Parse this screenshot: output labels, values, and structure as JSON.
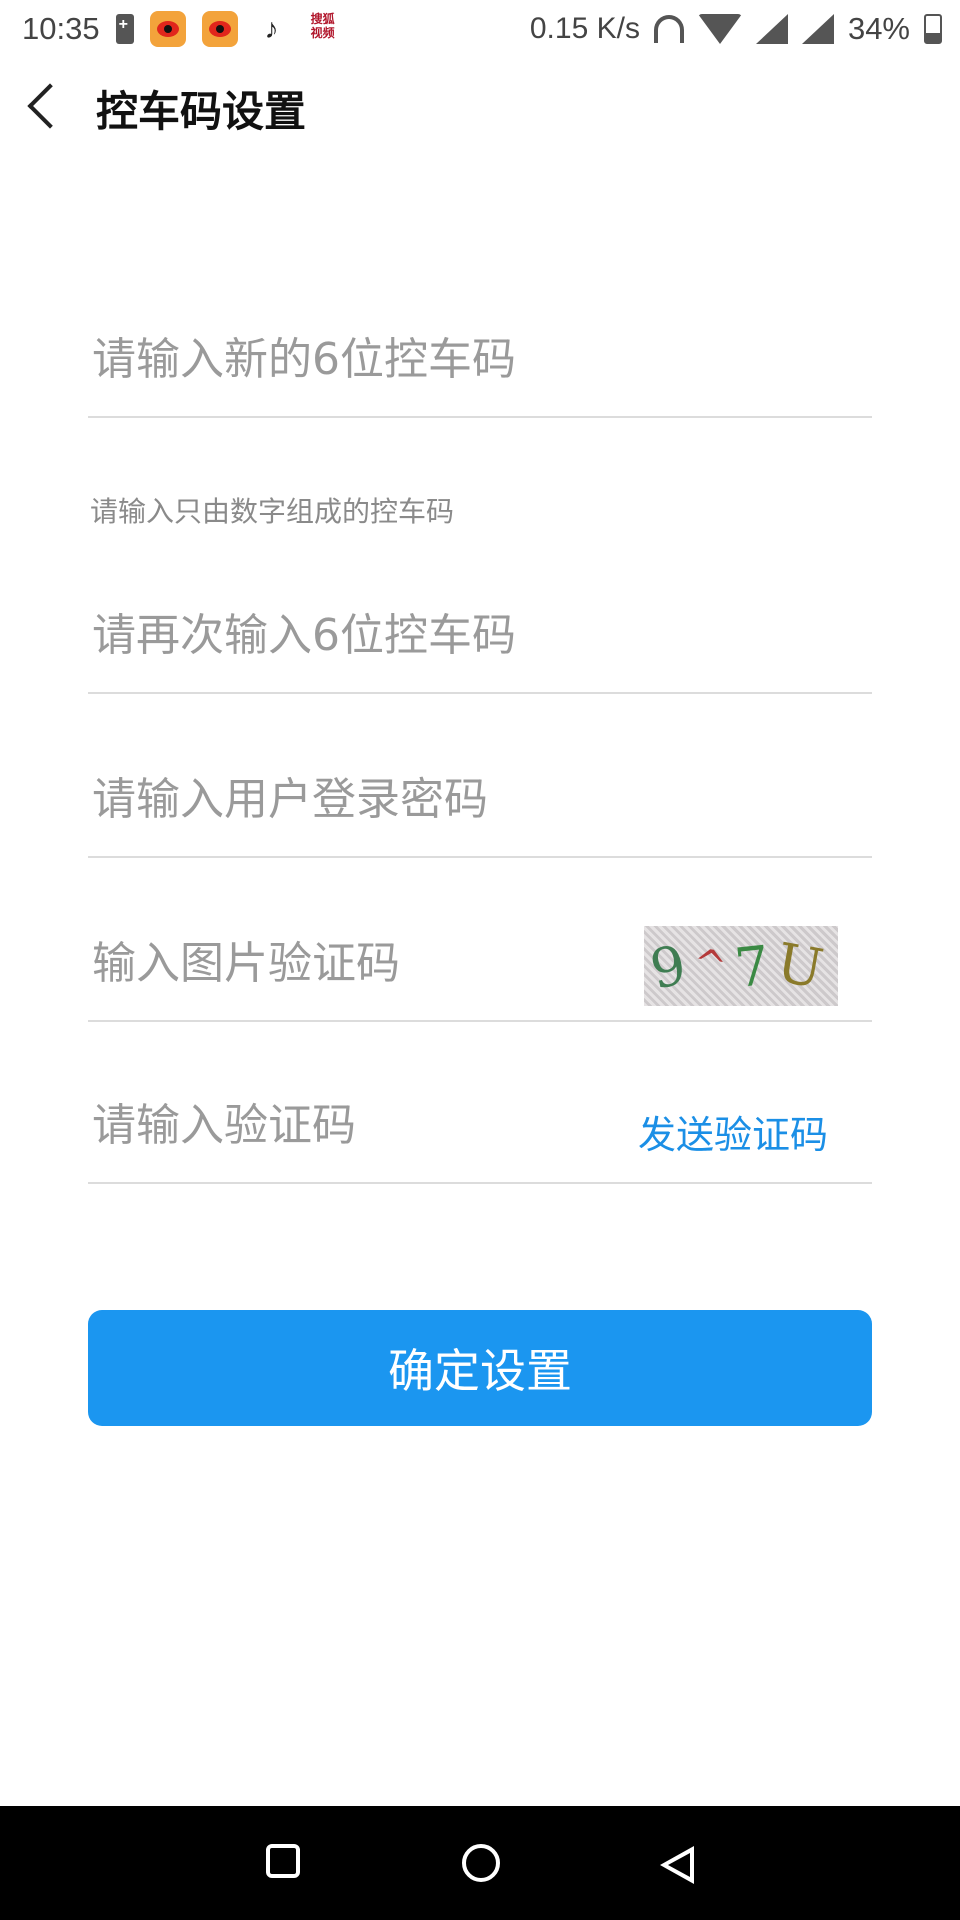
{
  "status_bar": {
    "time": "10:35",
    "net_speed": "0.15 K/s",
    "battery": "34%",
    "battery_level": 0.34,
    "icons": [
      "battery-saver-icon",
      "weibo-icon",
      "weibo-icon",
      "tiktok-icon",
      "sohu-video-icon",
      "headphone-icon",
      "wifi-icon",
      "signal-icon",
      "signal-icon",
      "battery-icon"
    ],
    "sohu_label_top": "搜狐",
    "sohu_label_bottom": "视频"
  },
  "header": {
    "title": "控车码设置"
  },
  "form": {
    "new_code_placeholder": "请输入新的6位控车码",
    "hint": "请输入只由数字组成的控车码",
    "confirm_code_placeholder": "请再次输入6位控车码",
    "password_placeholder": "请输入用户登录密码",
    "captcha_placeholder": "输入图片验证码",
    "captcha_text": [
      "9",
      "^",
      "7",
      "U"
    ],
    "sms_placeholder": "请输入验证码",
    "send_code_label": "发送验证码"
  },
  "actions": {
    "confirm_label": "确定设置"
  },
  "colors": {
    "accent": "#1b96f0",
    "link": "#1b8fe6"
  }
}
